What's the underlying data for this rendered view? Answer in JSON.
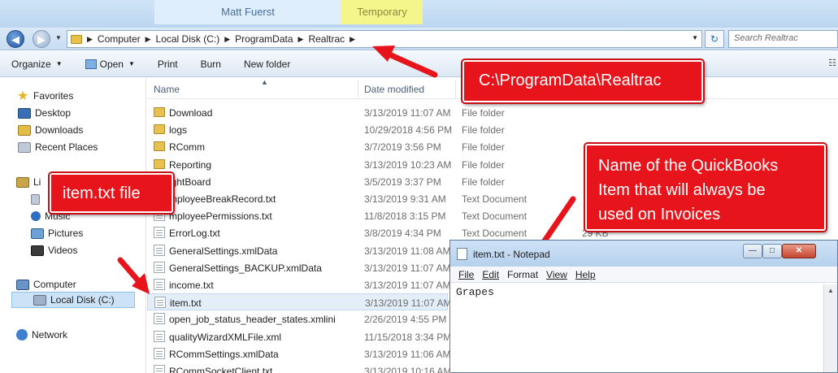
{
  "background_windows": {
    "tab1": "Matt Fuerst",
    "tab2": "Temporary"
  },
  "address_bar": {
    "crumbs": [
      "Computer",
      "Local Disk (C:)",
      "ProgramData",
      "Realtrac"
    ],
    "search_placeholder": "Search Realtrac"
  },
  "toolbar": {
    "organize": "Organize",
    "open": "Open",
    "print": "Print",
    "burn": "Burn",
    "new_folder": "New folder"
  },
  "sidebar": {
    "favorites": "Favorites",
    "desktop": "Desktop",
    "downloads": "Downloads",
    "recent_places": "Recent Places",
    "libraries": "Li",
    "documents": "",
    "music": "Music",
    "pictures": "Pictures",
    "videos": "Videos",
    "computer": "Computer",
    "local_disk": "Local Disk (C:)",
    "network": "Network"
  },
  "columns": {
    "name": "Name",
    "date": "Date modified",
    "type": "T"
  },
  "files": [
    {
      "name": "Download",
      "date": "3/13/2019 11:07 AM",
      "type": "File folder",
      "size": "",
      "icon": "folder"
    },
    {
      "name": "logs",
      "date": "10/29/2018 4:56 PM",
      "type": "File folder",
      "size": "",
      "icon": "folder"
    },
    {
      "name": "RComm",
      "date": "3/7/2019 3:56 PM",
      "type": "File folder",
      "size": "",
      "icon": "folder"
    },
    {
      "name": "Reporting",
      "date": "3/13/2019 10:23 AM",
      "type": "File folder",
      "size": "",
      "icon": "folder"
    },
    {
      "name": "ightBoard",
      "date": "3/5/2019 3:37 PM",
      "type": "File folder",
      "size": "",
      "icon": "folder"
    },
    {
      "name": "mployeeBreakRecord.txt",
      "date": "3/13/2019 9:31 AM",
      "type": "Text Document",
      "size": "",
      "icon": "doc"
    },
    {
      "name": "mployeePermissions.txt",
      "date": "11/8/2018 3:15 PM",
      "type": "Text Document",
      "size": "",
      "icon": "doc"
    },
    {
      "name": "ErrorLog.txt",
      "date": "3/8/2019 4:34 PM",
      "type": "Text Document",
      "size": "29 KB",
      "icon": "doc"
    },
    {
      "name": "GeneralSettings.xmlData",
      "date": "3/13/2019 11:08 AM",
      "type": "",
      "size": "",
      "icon": "doc"
    },
    {
      "name": "GeneralSettings_BACKUP.xmlData",
      "date": "3/13/2019 11:07 AM",
      "type": "",
      "size": "",
      "icon": "doc"
    },
    {
      "name": "income.txt",
      "date": "3/13/2019 11:07 AM",
      "type": "",
      "size": "",
      "icon": "doc"
    },
    {
      "name": "item.txt",
      "date": "3/13/2019 11:07 AM",
      "type": "",
      "size": "",
      "icon": "doc"
    },
    {
      "name": "open_job_status_header_states.xmlini",
      "date": "2/26/2019 4:55 PM",
      "type": "",
      "size": "",
      "icon": "doc"
    },
    {
      "name": "qualityWizardXMLFile.xml",
      "date": "11/15/2018 3:34 PM",
      "type": "",
      "size": "",
      "icon": "doc"
    },
    {
      "name": "RCommSettings.xmlData",
      "date": "3/13/2019 11:06 AM",
      "type": "",
      "size": "",
      "icon": "doc"
    },
    {
      "name": "RCommSocketClient.txt",
      "date": "3/13/2019 10:16 AM",
      "type": "",
      "size": "",
      "icon": "doc"
    }
  ],
  "callouts": {
    "path": "C:\\ProgramData\\Realtrac",
    "file": "item.txt file",
    "item_line1": "Name of the QuickBooks",
    "item_line2": "Item that will always be",
    "item_line3": "used on Invoices"
  },
  "notepad": {
    "title": "item.txt - Notepad",
    "menu": [
      "File",
      "Edit",
      "Format",
      "View",
      "Help"
    ],
    "content": "Grapes"
  },
  "colors": {
    "callout": "#e8141b",
    "selection": "#cce3f7"
  }
}
